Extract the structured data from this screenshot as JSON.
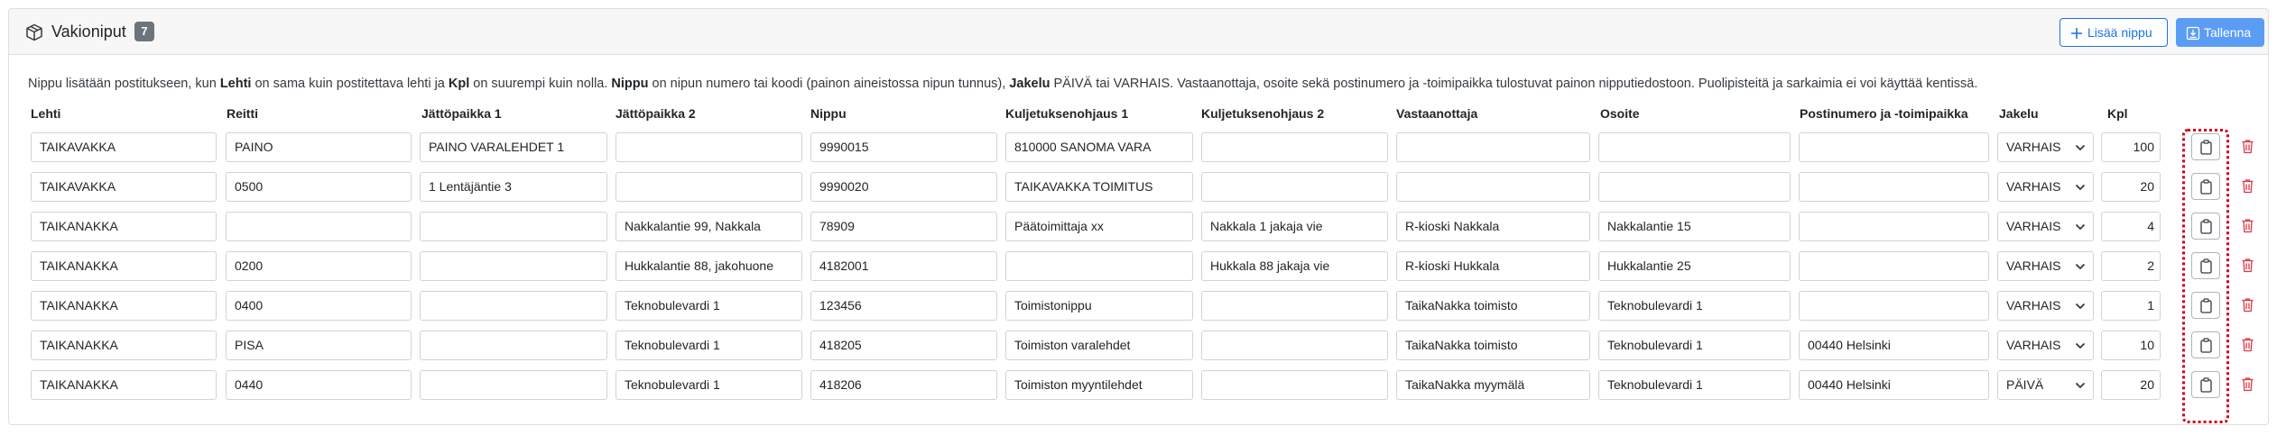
{
  "header": {
    "title": "Vakioniput",
    "count": "7",
    "add_button": "Lisää nippu",
    "save_button": "Tallenna",
    "title_icon": "box-icon",
    "add_icon": "plus-icon",
    "save_icon": "save-icon"
  },
  "help": {
    "p1": "Nippu lisätään postitukseen, kun ",
    "b1": "Lehti",
    "p2": " on sama kuin postitettava lehti ja ",
    "b2": "Kpl",
    "p3": " on suurempi kuin nolla. ",
    "b3": "Nippu",
    "p4": " on nipun numero tai koodi (painon aineistossa nipun tunnus), ",
    "b4": "Jakelu",
    "p5": " PÄIVÄ tai VARHAIS. Vastaanottaja, osoite sekä postinumero ja -toimipaikka tulostuvat painon nipputiedostoon. Puolipisteitä ja sarkaimia ei voi käyttää kentissä."
  },
  "columns": [
    "Lehti",
    "Reitti",
    "Jättöpaikka 1",
    "Jättöpaikka 2",
    "Nippu",
    "Kuljetuksenohjaus 1",
    "Kuljetuksenohjaus 2",
    "Vastaanottaja",
    "Osoite",
    "Postinumero ja -toimipaikka",
    "Jakelu",
    "Kpl"
  ],
  "rows": [
    {
      "lehti": "TAIKAVAKKA",
      "reitti": "PAINO",
      "jatto1": "PAINO VARALEHDET 1",
      "jatto2": "",
      "nippu": "9990015",
      "kulj1": "810000 SANOMA VARA",
      "kulj2": "",
      "vastaanottaja": "",
      "osoite": "",
      "postinumero": "",
      "jakelu": "VARHAIS",
      "kpl": "100"
    },
    {
      "lehti": "TAIKAVAKKA",
      "reitti": "0500",
      "jatto1": "1 Lentäjäntie 3",
      "jatto2": "",
      "nippu": "9990020",
      "kulj1": "TAIKAVAKKA TOIMITUS",
      "kulj2": "",
      "vastaanottaja": "",
      "osoite": "",
      "postinumero": "",
      "jakelu": "VARHAIS",
      "kpl": "20"
    },
    {
      "lehti": "TAIKANAKKA",
      "reitti": "",
      "jatto1": "",
      "jatto2": "Nakkalantie 99, Nakkala",
      "nippu": "78909",
      "kulj1": "Päätoimittaja xx",
      "kulj2": "Nakkala 1 jakaja vie",
      "vastaanottaja": "R-kioski Nakkala",
      "osoite": "Nakkalantie 15",
      "postinumero": "",
      "jakelu": "VARHAIS",
      "kpl": "4"
    },
    {
      "lehti": "TAIKANAKKA",
      "reitti": "0200",
      "jatto1": "",
      "jatto2": "Hukkalantie 88, jakohuone",
      "nippu": "4182001",
      "kulj1": "",
      "kulj2": "Hukkala 88 jakaja vie",
      "vastaanottaja": "R-kioski Hukkala",
      "osoite": "Hukkalantie 25",
      "postinumero": "",
      "jakelu": "VARHAIS",
      "kpl": "2"
    },
    {
      "lehti": "TAIKANAKKA",
      "reitti": "0400",
      "jatto1": "",
      "jatto2": "Teknobulevardi 1",
      "nippu": "123456",
      "kulj1": "Toimistonippu",
      "kulj2": "",
      "vastaanottaja": "TaikaNakka toimisto",
      "osoite": "Teknobulevardi 1",
      "postinumero": "",
      "jakelu": "VARHAIS",
      "kpl": "1"
    },
    {
      "lehti": "TAIKANAKKA",
      "reitti": "PISA",
      "jatto1": "",
      "jatto2": "Teknobulevardi 1",
      "nippu": "418205",
      "kulj1": "Toimiston varalehdet",
      "kulj2": "",
      "vastaanottaja": "TaikaNakka toimisto",
      "osoite": "Teknobulevardi 1",
      "postinumero": "00440 Helsinki",
      "jakelu": "VARHAIS",
      "kpl": "10"
    },
    {
      "lehti": "TAIKANAKKA",
      "reitti": "0440",
      "jatto1": "",
      "jatto2": "Teknobulevardi 1",
      "nippu": "418206",
      "kulj1": "Toimiston myyntilehdet",
      "kulj2": "",
      "vastaanottaja": "TaikaNakka myymälä",
      "osoite": "Teknobulevardi 1",
      "postinumero": "00440 Helsinki",
      "jakelu": "PÄIVÄ",
      "kpl": "20"
    }
  ],
  "row_actions": {
    "copy_icon": "copy-icon",
    "delete_icon": "trash-icon"
  },
  "colors": {
    "primary": "#1a73e8",
    "save": "#5b9cf5",
    "danger": "#dc3545",
    "highlight": "#d0021b",
    "badge": "#6c757d"
  }
}
